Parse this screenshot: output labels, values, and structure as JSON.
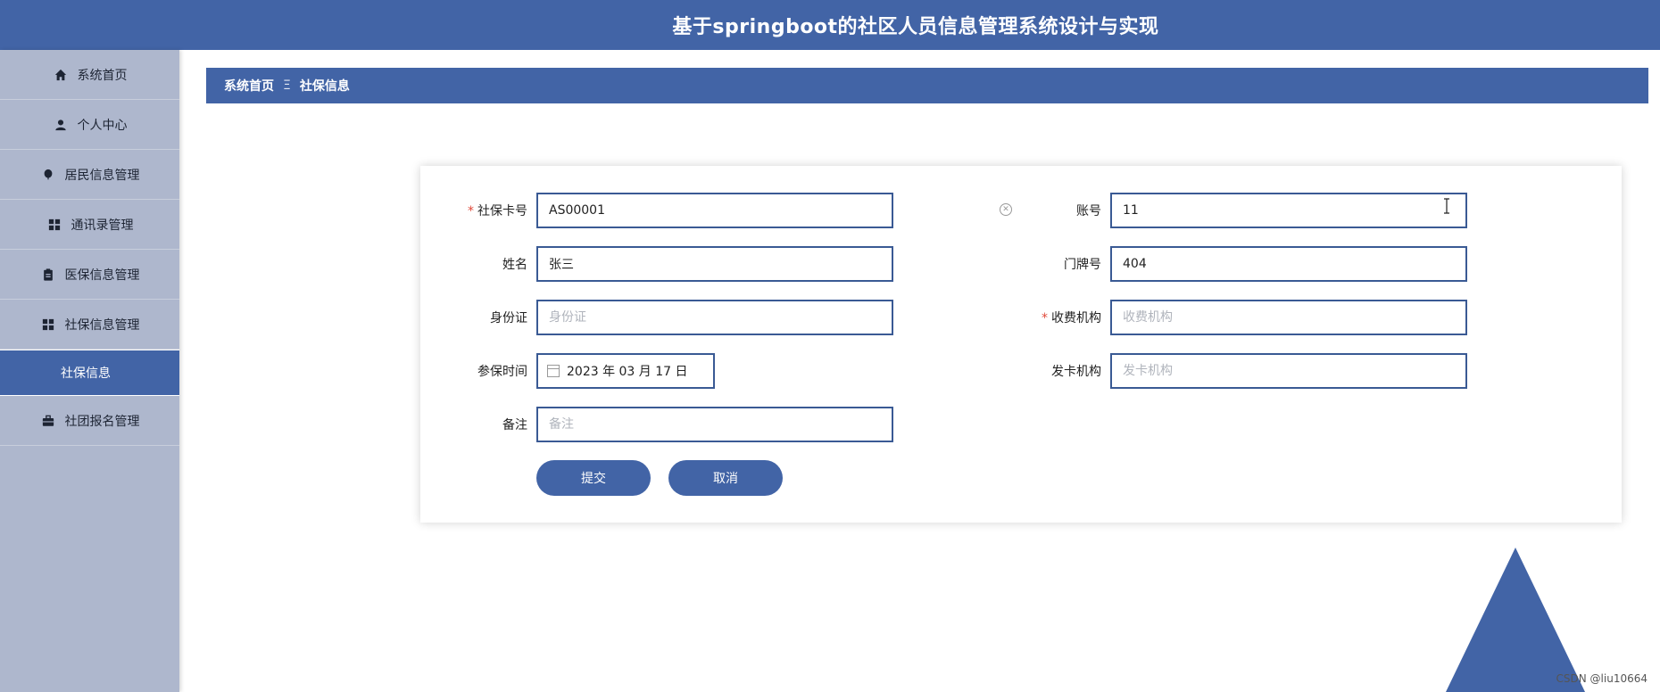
{
  "header": {
    "title": "基于springboot的社区人员信息管理系统设计与实现"
  },
  "sidebar": {
    "items": [
      {
        "label": "系统首页",
        "icon": "home-icon"
      },
      {
        "label": "个人中心",
        "icon": "user-icon"
      },
      {
        "label": "居民信息管理",
        "icon": "balloon-icon"
      },
      {
        "label": "通讯录管理",
        "icon": "grid-icon"
      },
      {
        "label": "医保信息管理",
        "icon": "clipboard-icon"
      },
      {
        "label": "社保信息管理",
        "icon": "grid-icon"
      },
      {
        "label": "社团报名管理",
        "icon": "briefcase-icon"
      }
    ],
    "sub_item": {
      "label": "社保信息"
    }
  },
  "breadcrumb": {
    "home": "系统首页",
    "separator": "Ξ",
    "current": "社保信息"
  },
  "form": {
    "card_no": {
      "label": "社保卡号",
      "value": "AS00001",
      "required": true
    },
    "account": {
      "label": "账号",
      "value": "11"
    },
    "name": {
      "label": "姓名",
      "value": "张三"
    },
    "door_no": {
      "label": "门牌号",
      "value": "404"
    },
    "id_card": {
      "label": "身份证",
      "placeholder": "身份证"
    },
    "fee_org": {
      "label": "收费机构",
      "placeholder": "收费机构",
      "required": true
    },
    "join_time": {
      "label": "参保时间",
      "value": "2023 年 03 月 17 日"
    },
    "card_org": {
      "label": "发卡机构",
      "placeholder": "发卡机构"
    },
    "remark": {
      "label": "备注",
      "placeholder": "备注"
    },
    "submit_label": "提交",
    "cancel_label": "取消"
  },
  "watermark": "CSDN @liu10664",
  "colors": {
    "primary": "#4264a6",
    "sidebar": "#aeb7cd",
    "required": "#e0493a"
  }
}
